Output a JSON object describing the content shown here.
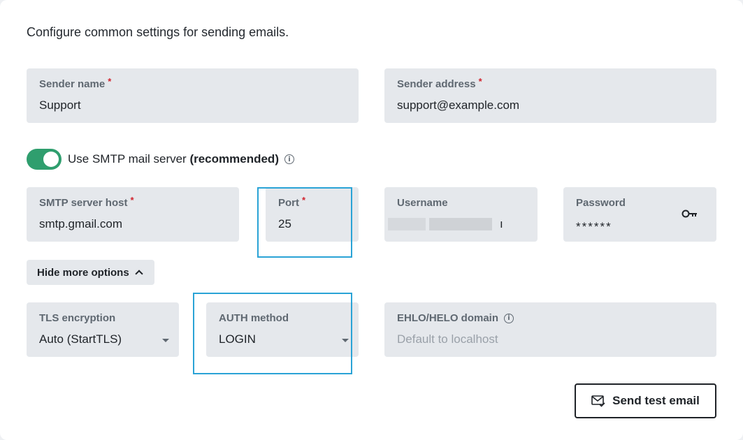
{
  "description": "Configure common settings for sending emails.",
  "sender_name": {
    "label": "Sender name",
    "required": "*",
    "value": "Support"
  },
  "sender_address": {
    "label": "Sender address",
    "required": "*",
    "value": "support@example.com"
  },
  "smtp_toggle": {
    "label": "Use SMTP mail server",
    "emphasis": "(recommended)",
    "enabled": true
  },
  "smtp_host": {
    "label": "SMTP server host",
    "required": "*",
    "value": "smtp.gmail.com"
  },
  "port": {
    "label": "Port",
    "required": "*",
    "value": "25"
  },
  "username": {
    "label": "Username",
    "value": "ı"
  },
  "password": {
    "label": "Password",
    "value": "******"
  },
  "more_options": {
    "label": "Hide more options"
  },
  "tls": {
    "label": "TLS encryption",
    "value": "Auto (StartTLS)"
  },
  "auth": {
    "label": "AUTH method",
    "value": "LOGIN"
  },
  "ehlo": {
    "label": "EHLO/HELO domain",
    "placeholder": "Default to localhost"
  },
  "send_test": {
    "label": "Send test email"
  },
  "colors": {
    "toggle_on": "#2f9e6e",
    "required": "#d1242f",
    "highlight": "#2aa3d6"
  }
}
